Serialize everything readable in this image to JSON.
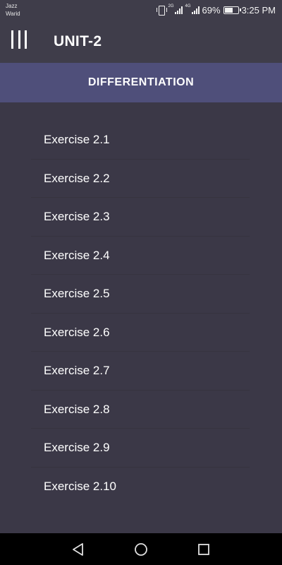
{
  "status_bar": {
    "carrier_line1": "Jazz",
    "carrier_line2": "Warid",
    "net1": "2G",
    "net2": "4G",
    "battery": "69%",
    "battery_level": 0.69,
    "time": "3:25 PM",
    "icons": [
      "vibrate-icon",
      "signal-icon",
      "battery-icon"
    ]
  },
  "app_bar": {
    "title": "UNIT-2",
    "menu_icon": "menu-icon"
  },
  "section": {
    "title": "DIFFERENTIATION"
  },
  "exercises": [
    {
      "label": "Exercise 2.1"
    },
    {
      "label": "Exercise 2.2"
    },
    {
      "label": "Exercise 2.3"
    },
    {
      "label": "Exercise 2.4"
    },
    {
      "label": "Exercise 2.5"
    },
    {
      "label": "Exercise 2.6"
    },
    {
      "label": "Exercise 2.7"
    },
    {
      "label": "Exercise 2.8"
    },
    {
      "label": "Exercise 2.9"
    },
    {
      "label": "Exercise 2.10"
    }
  ],
  "nav_bar": {
    "icons": [
      "back-icon",
      "home-icon",
      "recents-icon"
    ]
  },
  "colors": {
    "app_bar": "#3f3d4a",
    "section_header": "#4f4f7a",
    "list_background": "#3b3847",
    "text": "#ffffff"
  }
}
